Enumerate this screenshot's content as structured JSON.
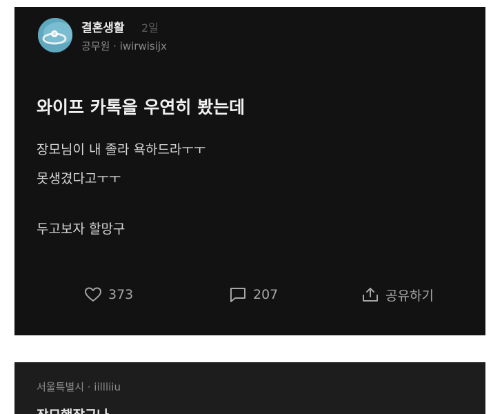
{
  "post": {
    "author": "결혼생활",
    "time": "2일",
    "meta": "공무원 · iwirwisijx",
    "title": "와이프 카톡을 우연히 봤는데",
    "body": [
      "장모님이 내 졸라 욕하드라ㅜㅜ",
      "못생겼다고ㅜㅜ",
      "두고보자 할망구"
    ],
    "likes": "373",
    "comments": "207",
    "share": "공유하기"
  },
  "reply": {
    "meta": "서울특별시 · iillliiu",
    "text": "장모했잖구나"
  },
  "colors": {
    "card": "#121212",
    "reply_card": "#1d1d1d",
    "avatar": "#5fa9c0"
  },
  "icons": [
    "heart-icon",
    "comment-icon",
    "share-icon"
  ]
}
